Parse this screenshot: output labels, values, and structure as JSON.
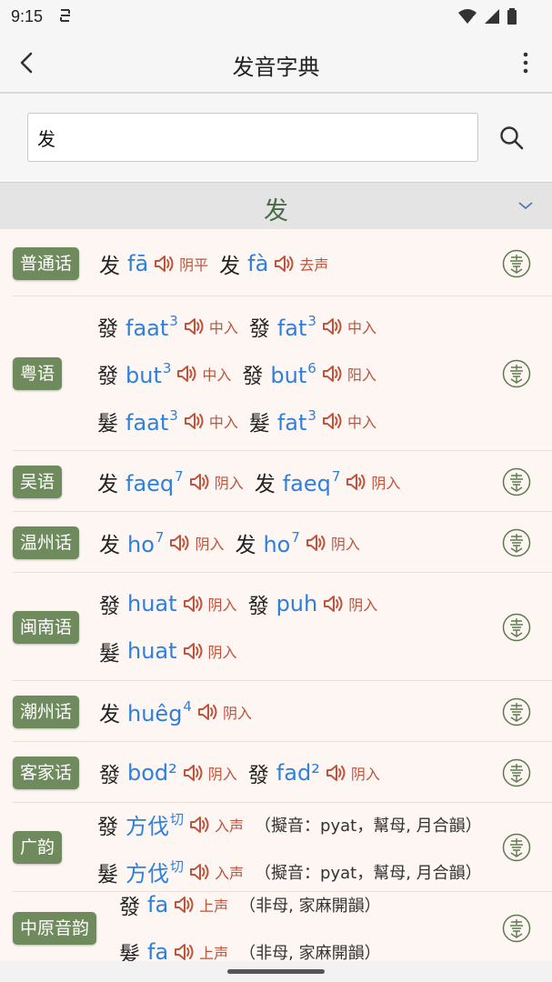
{
  "status": {
    "time": "9:15"
  },
  "app_bar": {
    "title": "发音字典"
  },
  "search": {
    "value": "发"
  },
  "char_header": {
    "char": "发"
  },
  "rows": [
    {
      "label": "普通话",
      "lines": [
        [
          {
            "hz": "发",
            "py": "fā",
            "sup": "",
            "tone": "阴平"
          },
          {
            "hz": "发",
            "py": "fà",
            "sup": "",
            "tone": "去声"
          }
        ]
      ]
    },
    {
      "label": "粤语",
      "lines": [
        [
          {
            "hz": "發",
            "py": "faat",
            "sup": "3",
            "tone": "中入"
          },
          {
            "hz": "發",
            "py": "fat",
            "sup": "3",
            "tone": "中入"
          }
        ],
        [
          {
            "hz": "發",
            "py": "but",
            "sup": "3",
            "tone": "中入"
          },
          {
            "hz": "發",
            "py": "but",
            "sup": "6",
            "tone": "阳入"
          }
        ],
        [
          {
            "hz": "髮",
            "py": "faat",
            "sup": "3",
            "tone": "中入"
          },
          {
            "hz": "髮",
            "py": "fat",
            "sup": "3",
            "tone": "中入"
          }
        ]
      ]
    },
    {
      "label": "吴语",
      "lines": [
        [
          {
            "hz": "发",
            "py": "faeq",
            "sup": "7",
            "tone": "阴入"
          },
          {
            "hz": "发",
            "py": "faeq",
            "sup": "7",
            "tone": "阴入"
          }
        ]
      ]
    },
    {
      "label": "温州话",
      "lines": [
        [
          {
            "hz": "发",
            "py": "ho",
            "sup": "7",
            "tone": "阴入"
          },
          {
            "hz": "发",
            "py": "ho",
            "sup": "7",
            "tone": "阴入"
          }
        ]
      ]
    },
    {
      "label": "闽南语",
      "lines": [
        [
          {
            "hz": "發",
            "py": "huat",
            "sup": "",
            "tone": "阴入"
          },
          {
            "hz": "發",
            "py": "puh",
            "sup": "",
            "tone": "阴入"
          }
        ],
        [
          {
            "hz": "髮",
            "py": "huat",
            "sup": "",
            "tone": "阴入"
          }
        ]
      ]
    },
    {
      "label": "潮州话",
      "lines": [
        [
          {
            "hz": "发",
            "py": "huêg",
            "sup": "4",
            "tone": "阴入"
          }
        ]
      ]
    },
    {
      "label": "客家话",
      "lines": [
        [
          {
            "hz": "發",
            "py": "bod²",
            "sup": "",
            "tone": "阴入"
          },
          {
            "hz": "發",
            "py": "fad²",
            "sup": "",
            "tone": "阴入"
          }
        ]
      ]
    },
    {
      "label": "广韵",
      "lines": [
        [
          {
            "hz": "發",
            "py": "方伐",
            "sup": "切",
            "tone": "入声",
            "extra": "（擬音：pyat，幫母, 月合韻）"
          }
        ],
        [
          {
            "hz": "髮",
            "py": "方伐",
            "sup": "切",
            "tone": "入声",
            "extra": "（擬音：pyat，幫母, 月合韻）"
          }
        ]
      ]
    },
    {
      "label": "中原音韵",
      "lines": [
        [
          {
            "hz": "發",
            "py": "fa",
            "sup": "",
            "tone": "上声",
            "extra": "（非母, 家麻開韻）"
          }
        ],
        [
          {
            "hz": "髮",
            "py": "fa",
            "sup": "",
            "tone": "上声",
            "extra": "（非母, 家麻開韻）"
          }
        ]
      ]
    }
  ],
  "colors": {
    "badge": "#6f8a5c",
    "pinyin": "#2f7fdc",
    "tone": "#c0533b",
    "header_char": "#4a6a45"
  }
}
